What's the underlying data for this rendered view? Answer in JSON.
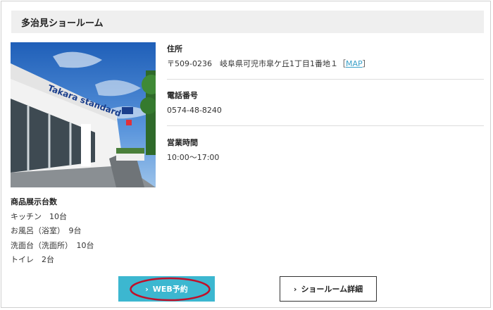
{
  "showroom": {
    "name": "多治見ショールーム"
  },
  "photo": {
    "sign_text": "Takara standard",
    "alt": "showroom-photo"
  },
  "address": {
    "label": "住所",
    "value": "〒509-0236　岐阜県可児市皐ケ丘1丁目1番地１",
    "bracket_open": "［",
    "map_link": "MAP",
    "bracket_close": "］"
  },
  "phone": {
    "label": "電話番号",
    "value": "0574-48-8240"
  },
  "hours": {
    "label": "営業時間",
    "value": "10:00～17:00"
  },
  "display_counts": {
    "title": "商品展示台数",
    "items": [
      "キッチン　10台",
      "お風呂（浴室）　9台",
      "洗面台（洗面所）　10台",
      "トイレ　2台"
    ]
  },
  "buttons": {
    "web_reservation": "WEB予約",
    "showroom_detail": "ショールーム詳細",
    "chevron": "›"
  },
  "colors": {
    "accent": "#3cb7d0",
    "link": "#3aa0c8",
    "annotation": "#c0102a"
  }
}
